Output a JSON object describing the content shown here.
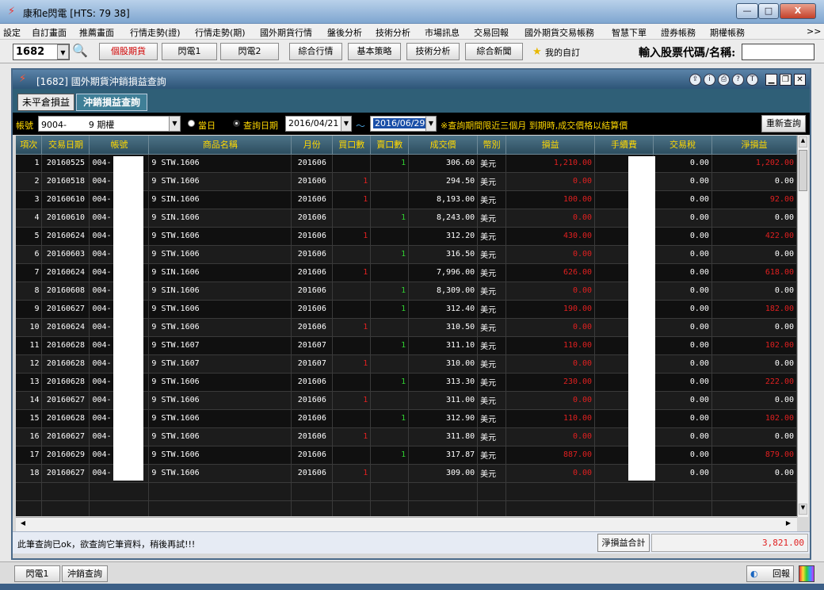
{
  "window": {
    "title": "康和e閃電 [HTS: 79 38]",
    "min": "—",
    "max": "□",
    "close": "X"
  },
  "menu": [
    "設定",
    "自訂畫面",
    "推薦畫面",
    "行情走勢(證)",
    "行情走勢(期)",
    "國外期貨行情",
    "盤後分析",
    "技術分析",
    "市場訊息",
    "交易回報",
    "國外期貨交易帳務",
    "智慧下單",
    "證券帳務",
    "期權帳務",
    ">>"
  ],
  "toolbar": {
    "code": "1682",
    "buttons": [
      "個股期貨",
      "閃電1",
      "閃電2",
      "綜合行情",
      "基本策略",
      "技術分析",
      "綜合新聞",
      "我的自訂"
    ],
    "search_label": "輸入股票代碼/名稱:",
    "search_value": ""
  },
  "child": {
    "title": "[1682] 國外期貨沖銷損益查詢"
  },
  "tabs": [
    "未平倉損益",
    "沖銷損益查詢"
  ],
  "filter": {
    "account_label": "帳號",
    "account_value": "9004-        9 期權",
    "today": "當日",
    "query_date": "查詢日期",
    "start_date": "2016/04/21",
    "tilde": "～",
    "end_date": "2016/06/29",
    "note": "※查詢期間限近三個月 到期時,成交價格以結算價",
    "refresh": "重新查詢"
  },
  "columns": [
    "項次",
    "交易日期",
    "帳號",
    "商品名稱",
    "月份",
    "買口數",
    "賣口數",
    "成交價",
    "幣別",
    "損益",
    "手續費",
    "交易稅",
    "淨損益"
  ],
  "rows": [
    [
      "1",
      "20160525",
      "004-",
      "9 STW.1606",
      "201606",
      "",
      "1",
      "306.60",
      "美元",
      "1,210.00",
      "",
      "0.00",
      "1,202.00"
    ],
    [
      "2",
      "20160518",
      "004-",
      "9 STW.1606",
      "201606",
      "1",
      "",
      "294.50",
      "美元",
      "0.00",
      "",
      "0.00",
      "0.00"
    ],
    [
      "3",
      "20160610",
      "004-",
      "9 SIN.1606",
      "201606",
      "1",
      "",
      "8,193.00",
      "美元",
      "100.00",
      "",
      "0.00",
      "92.00"
    ],
    [
      "4",
      "20160610",
      "004-",
      "9 SIN.1606",
      "201606",
      "",
      "1",
      "8,243.00",
      "美元",
      "0.00",
      "",
      "0.00",
      "0.00"
    ],
    [
      "5",
      "20160624",
      "004-",
      "9 STW.1606",
      "201606",
      "1",
      "",
      "312.20",
      "美元",
      "430.00",
      "",
      "0.00",
      "422.00"
    ],
    [
      "6",
      "20160603",
      "004-",
      "9 STW.1606",
      "201606",
      "",
      "1",
      "316.50",
      "美元",
      "0.00",
      "",
      "0.00",
      "0.00"
    ],
    [
      "7",
      "20160624",
      "004-",
      "9 SIN.1606",
      "201606",
      "1",
      "",
      "7,996.00",
      "美元",
      "626.00",
      "",
      "0.00",
      "618.00"
    ],
    [
      "8",
      "20160608",
      "004-",
      "9 SIN.1606",
      "201606",
      "",
      "1",
      "8,309.00",
      "美元",
      "0.00",
      "",
      "0.00",
      "0.00"
    ],
    [
      "9",
      "20160627",
      "004-",
      "9 STW.1606",
      "201606",
      "",
      "1",
      "312.40",
      "美元",
      "190.00",
      "",
      "0.00",
      "182.00"
    ],
    [
      "10",
      "20160624",
      "004-",
      "9 STW.1606",
      "201606",
      "1",
      "",
      "310.50",
      "美元",
      "0.00",
      "",
      "0.00",
      "0.00"
    ],
    [
      "11",
      "20160628",
      "004-",
      "9 STW.1607",
      "201607",
      "",
      "1",
      "311.10",
      "美元",
      "110.00",
      "",
      "0.00",
      "102.00"
    ],
    [
      "12",
      "20160628",
      "004-",
      "9 STW.1607",
      "201607",
      "1",
      "",
      "310.00",
      "美元",
      "0.00",
      "",
      "0.00",
      "0.00"
    ],
    [
      "13",
      "20160628",
      "004-",
      "9 STW.1606",
      "201606",
      "",
      "1",
      "313.30",
      "美元",
      "230.00",
      "",
      "0.00",
      "222.00"
    ],
    [
      "14",
      "20160627",
      "004-",
      "9 STW.1606",
      "201606",
      "1",
      "",
      "311.00",
      "美元",
      "0.00",
      "",
      "0.00",
      "0.00"
    ],
    [
      "15",
      "20160628",
      "004-",
      "9 STW.1606",
      "201606",
      "",
      "1",
      "312.90",
      "美元",
      "110.00",
      "",
      "0.00",
      "102.00"
    ],
    [
      "16",
      "20160627",
      "004-",
      "9 STW.1606",
      "201606",
      "1",
      "",
      "311.80",
      "美元",
      "0.00",
      "",
      "0.00",
      "0.00"
    ],
    [
      "17",
      "20160629",
      "004-",
      "9 STW.1606",
      "201606",
      "",
      "1",
      "317.87",
      "美元",
      "887.00",
      "",
      "0.00",
      "879.00"
    ],
    [
      "18",
      "20160627",
      "004-",
      "9 STW.1606",
      "201606",
      "1",
      "",
      "309.00",
      "美元",
      "0.00",
      "",
      "0.00",
      "0.00"
    ]
  ],
  "status": {
    "message": "此筆查詢已ok，欲查詢它筆資料，稍後再試!!!",
    "total_label": "淨損益合計",
    "total_value": "3,821.00"
  },
  "taskbar": {
    "tabs": [
      "閃電1",
      "沖銷查詢"
    ],
    "report": "回報"
  },
  "colors": {
    "loss_profit": "#e02020",
    "sell": "#30d030",
    "header_text": "#ffd800"
  }
}
